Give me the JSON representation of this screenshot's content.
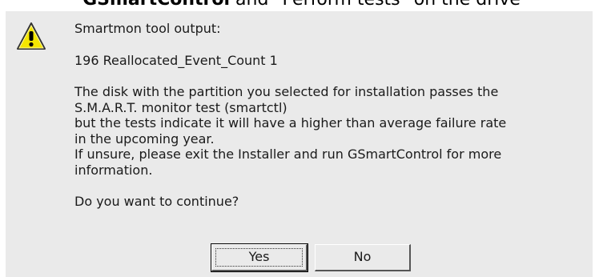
{
  "background_text": {
    "bold": "GSmartControl",
    "rest": " and \"Perform tests\" on the drive"
  },
  "dialog": {
    "icon": "warning-icon",
    "lines": [
      "Smartmon tool output:",
      "",
      "196 Reallocated_Event_Count 1",
      "",
      "The disk with the partition you selected for installation passes the",
      "S.M.A.R.T. monitor test (smartctl)",
      "but the tests indicate it will have a higher than average failure rate",
      "in the upcoming year.",
      "If unsure, please exit the Installer and run GSmartControl for more",
      "information.",
      "",
      "Do you want to continue?"
    ],
    "buttons": {
      "yes": "Yes",
      "no": "No"
    }
  },
  "colors": {
    "dialog_bg": "#eaeaea",
    "icon_fill": "#f5e600"
  }
}
